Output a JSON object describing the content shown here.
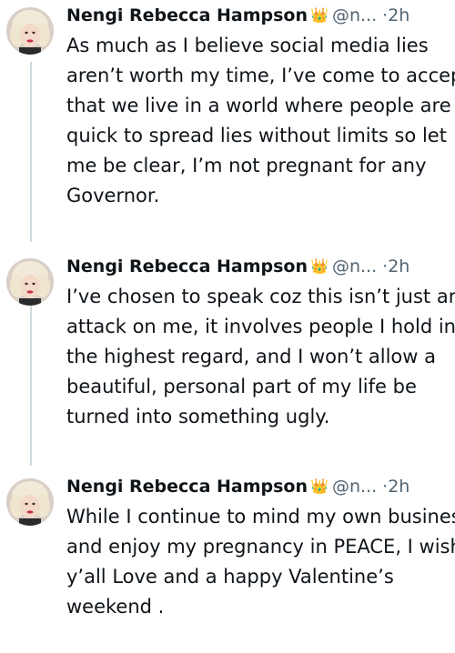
{
  "tweets": [
    {
      "author_name": "Nengi Rebecca Hampson",
      "badge_emoji": "👑",
      "handle": "@n...",
      "separator": "·",
      "time": "2h",
      "lines": [
        "As much as I believe social media lies",
        "aren’t worth my time, I’ve come to accep",
        "that we live in a world where people are",
        "quick to spread lies without limits so let",
        "me be clear, I’m not pregnant for any",
        "Governor."
      ]
    },
    {
      "author_name": "Nengi Rebecca Hampson",
      "badge_emoji": "👑",
      "handle": "@n...",
      "separator": "·",
      "time": "2h",
      "lines": [
        "I’ve chosen to speak coz this isn’t just ar",
        "attack on me, it involves people I hold in",
        "the highest regard, and I won’t allow a",
        "beautiful, personal part of my life be",
        "turned into something ugly."
      ]
    },
    {
      "author_name": "Nengi Rebecca Hampson",
      "badge_emoji": "👑",
      "handle": "@n...",
      "separator": "·",
      "time": "2h",
      "lines": [
        "While I continue to mind my own busines",
        "and enjoy my pregnancy in PEACE, I wish",
        "y’all Love and a happy Valentine’s",
        "weekend ."
      ]
    }
  ]
}
